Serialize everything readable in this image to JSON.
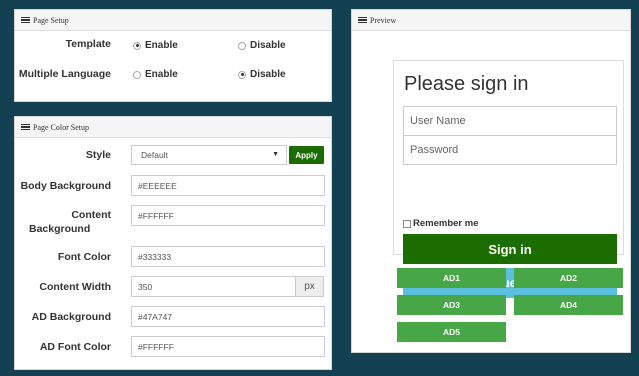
{
  "page_setup": {
    "title": "Page Setup",
    "template": {
      "label": "Template",
      "options": [
        "Enable",
        "Disable"
      ],
      "selected": "Enable"
    },
    "multiple_language": {
      "label": "Multiple Language",
      "options": [
        "Enable",
        "Disable"
      ],
      "selected": "Disable"
    }
  },
  "color_setup": {
    "title": "Page Color Setup",
    "style": {
      "label": "Style",
      "value": "Default",
      "apply_label": "Apply"
    },
    "body_background": {
      "label": "Body Background",
      "value": "#EEEEEE"
    },
    "content_background": {
      "label_line1": "Content",
      "label_line2": "Background",
      "value": "#FFFFFF"
    },
    "font_color": {
      "label": "Font Color",
      "value": "#333333"
    },
    "content_width": {
      "label": "Content Width",
      "value": "350",
      "unit": "px"
    },
    "ad_background": {
      "label": "AD Background",
      "value": "#47A747"
    },
    "ad_font_color": {
      "label": "AD Font Color",
      "value": "#FFFFFF"
    }
  },
  "preview": {
    "title": "Preview",
    "heading": "Please sign in",
    "username_placeholder": "User Name",
    "password_placeholder": "Password",
    "remember_label": "Remember me",
    "sign_in_label": "Sign in",
    "guest_label": "Guest",
    "ads": [
      "AD1",
      "AD2",
      "AD3",
      "AD4",
      "AD5"
    ]
  },
  "colors": {
    "background": "#134152",
    "apply_green": "#1b6d00",
    "sign_in_green": "#1b6d00",
    "guest_blue": "#5bc0de",
    "ad_green": "#47a747"
  }
}
